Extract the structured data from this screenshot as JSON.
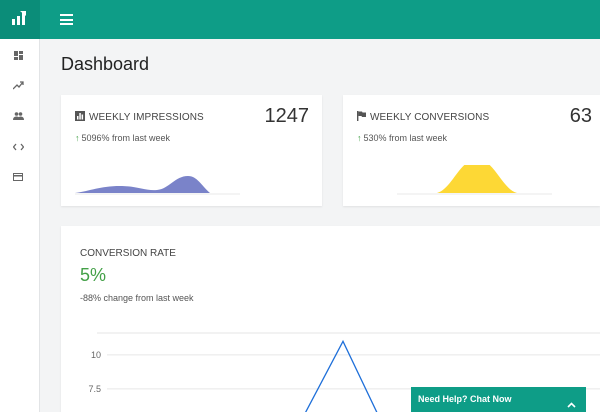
{
  "topbar": {
    "logo_icon": "bar-chart-icon",
    "menu_icon": "hamburger-menu-icon",
    "brand_color": "#0e9d87"
  },
  "sidebar": {
    "items": [
      {
        "icon": "dashboard-icon"
      },
      {
        "icon": "trending-up-icon"
      },
      {
        "icon": "people-icon"
      },
      {
        "icon": "code-icon"
      },
      {
        "icon": "credit-card-icon"
      }
    ]
  },
  "page": {
    "title": "Dashboard"
  },
  "cards": [
    {
      "title": "WEEKLY IMPRESSIONS",
      "icon": "bar-chart-icon",
      "value": "1247",
      "change_arrow": "↑",
      "change": "5096% from last week",
      "spark_color": "#7a83c9"
    },
    {
      "title": "WEEKLY CONVERSIONS",
      "icon": "flag-icon",
      "value": "63",
      "change_arrow": "↑",
      "change": "530% from last week",
      "spark_color": "#fdd835"
    }
  ],
  "conversion": {
    "title": "CONVERSION RATE",
    "value": "5%",
    "change": "-88% change from last week",
    "value_color": "#43a047"
  },
  "chart_data": {
    "type": "line",
    "y_ticks": [
      "10",
      "7.5"
    ],
    "ylim": [
      5.5,
      12.5
    ],
    "peak_value": 11,
    "line_color": "#1e6fd9"
  },
  "chat": {
    "label": "Need Help? Chat Now",
    "icon": "chevron-up-icon"
  }
}
